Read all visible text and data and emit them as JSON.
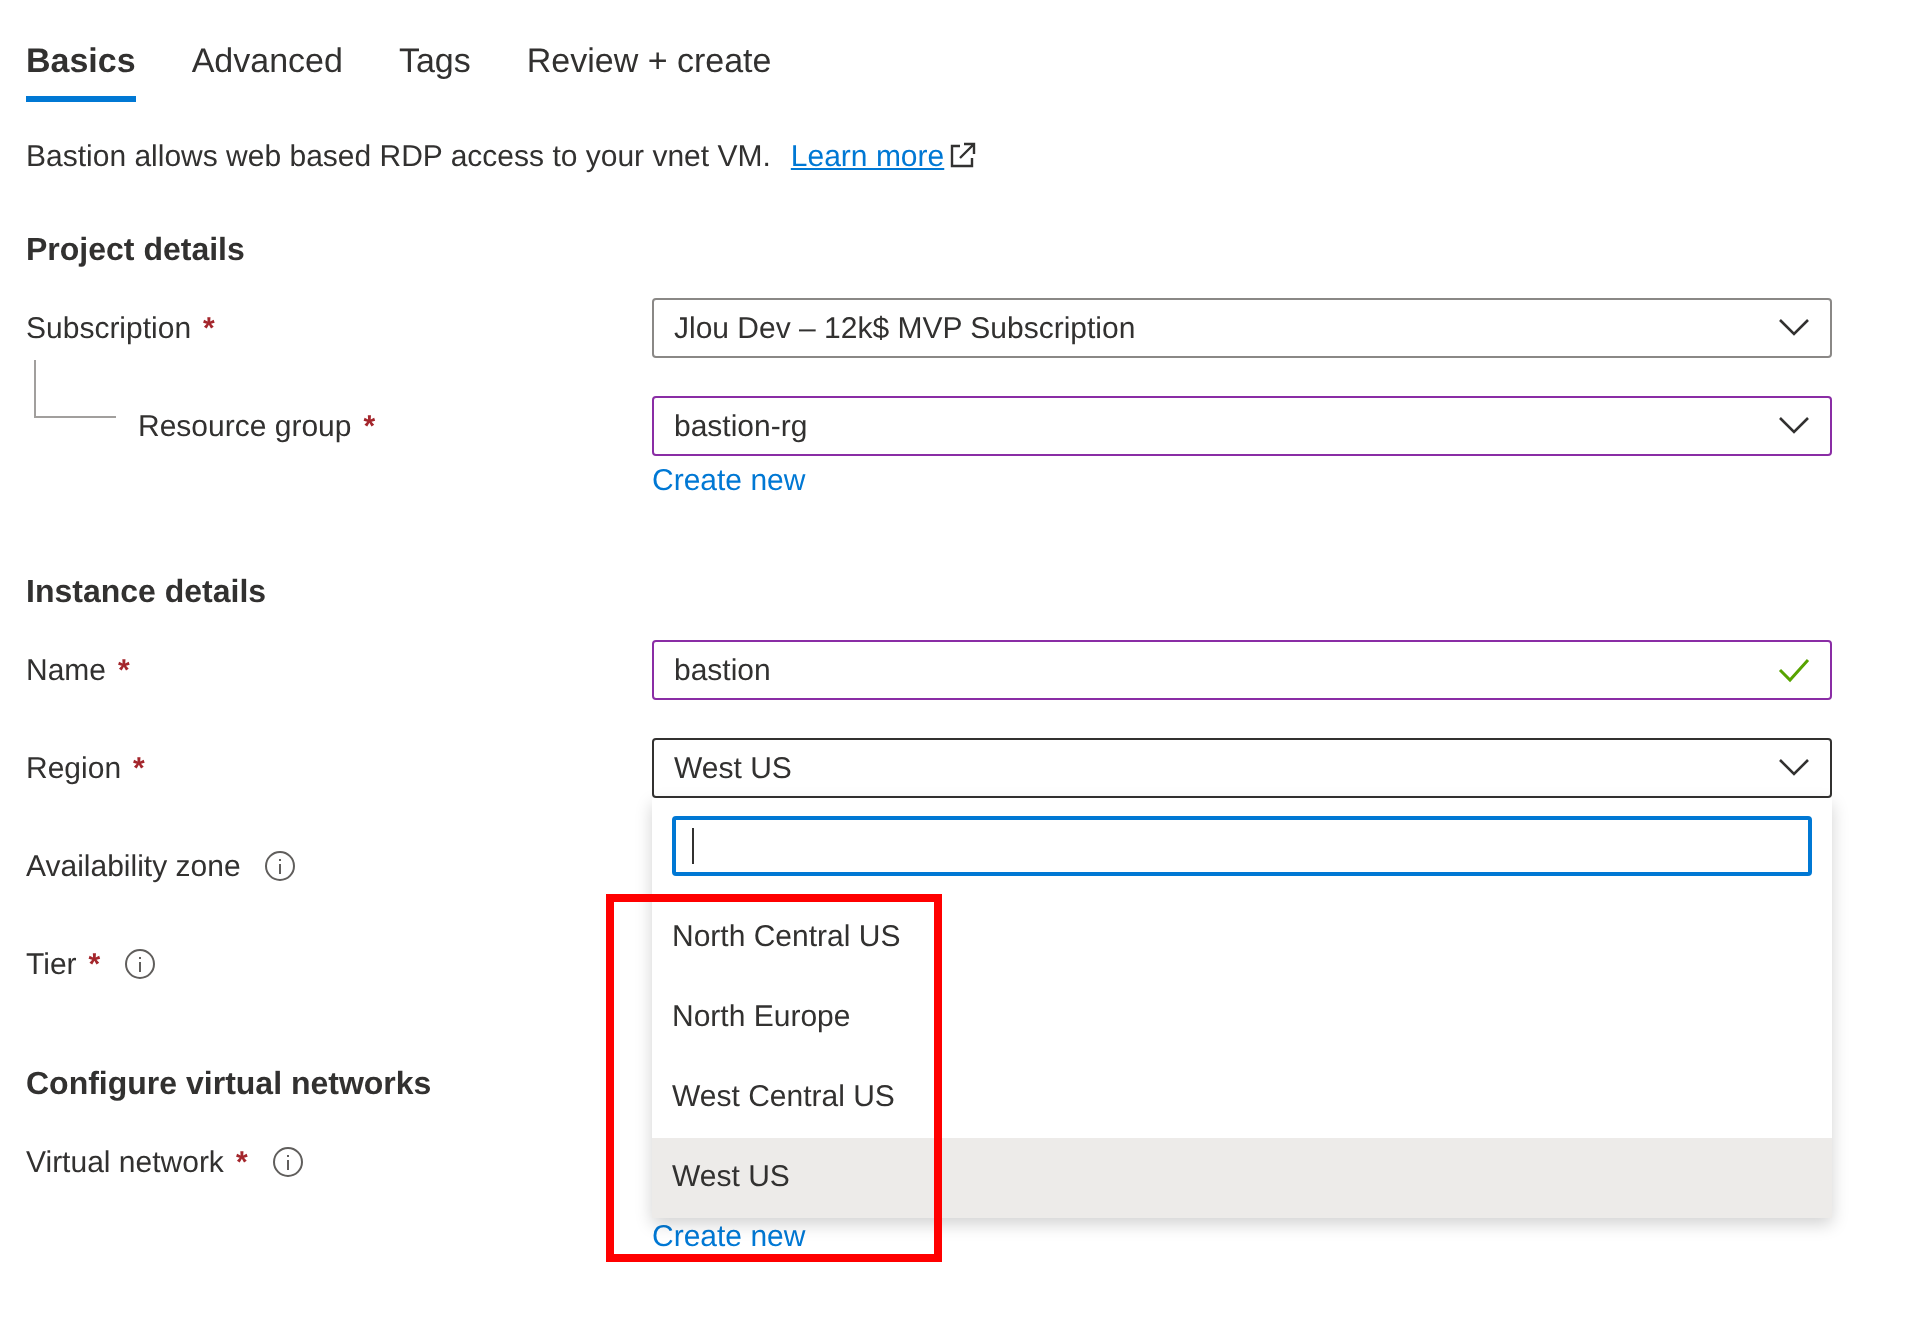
{
  "tabs": [
    {
      "label": "Basics",
      "selected": true
    },
    {
      "label": "Advanced",
      "selected": false
    },
    {
      "label": "Tags",
      "selected": false
    },
    {
      "label": "Review + create",
      "selected": false
    }
  ],
  "intro": {
    "text": "Bastion allows web based RDP access to your vnet VM.",
    "link": "Learn more"
  },
  "sections": [
    {
      "title": "Project details",
      "fields": [
        {
          "label": "Subscription",
          "mark": "*",
          "kind": "select",
          "value": "Jlou Dev – 12k$ MVP Subscription",
          "edited": false
        },
        {
          "label": "Resource group",
          "mark": "*",
          "kind": "select",
          "nested": true,
          "value": "bastion-rg",
          "edited": true,
          "link": "Create new"
        }
      ]
    },
    {
      "title": "Instance details",
      "fields": [
        {
          "label": "Name",
          "mark": "*",
          "kind": "text",
          "value": "bastion",
          "edited": true,
          "valid": true
        },
        {
          "label": "Region",
          "mark": "*",
          "kind": "select",
          "value": "West US",
          "edited": false,
          "open": true
        },
        {
          "label": "Availability zone",
          "info": true,
          "kind": "none"
        },
        {
          "label": "Tier",
          "mark": "*",
          "info": true,
          "kind": "none"
        }
      ]
    },
    {
      "title": "Configure virtual networks",
      "fields": [
        {
          "label": "Virtual network",
          "mark": "*",
          "info": true,
          "kind": "none",
          "link": "Create new"
        }
      ]
    }
  ],
  "dropdown": {
    "options": [
      {
        "label": "North Central US",
        "selected": false
      },
      {
        "label": "North Europe",
        "selected": false
      },
      {
        "label": "West Central US",
        "selected": false
      },
      {
        "label": "West US",
        "selected": true
      }
    ]
  }
}
